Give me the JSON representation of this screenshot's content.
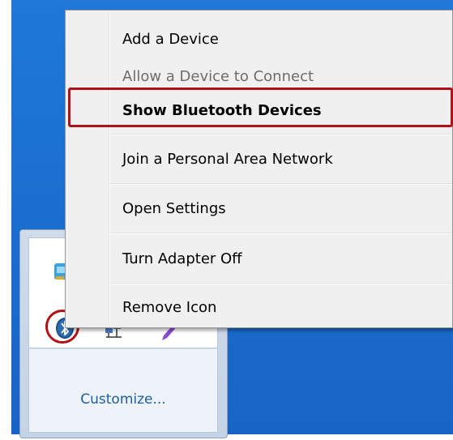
{
  "context_menu": {
    "items": [
      {
        "label": "Add a Device",
        "state": "enabled"
      },
      {
        "label": "Allow a Device to Connect",
        "state": "disabled"
      },
      {
        "label": "Show Bluetooth Devices",
        "state": "default"
      },
      {
        "label": "Join a Personal Area Network",
        "state": "enabled"
      },
      {
        "label": "Open Settings",
        "state": "enabled"
      },
      {
        "label": "Turn Adapter Off",
        "state": "enabled"
      },
      {
        "label": "Remove Icon",
        "state": "enabled"
      }
    ]
  },
  "tray_overflow": {
    "customize_label": "Customize...",
    "icons": [
      "app-icon",
      "bluetooth-icon",
      "network-icon",
      "pen-icon"
    ]
  },
  "colors": {
    "desktop": "#1b6fd0",
    "highlight": "#b01217",
    "link": "#1e5ea8"
  }
}
